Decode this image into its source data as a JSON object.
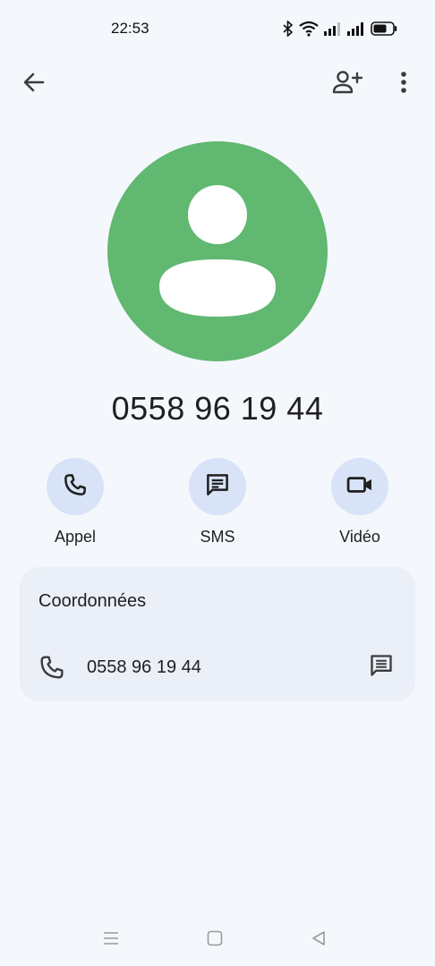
{
  "status_bar": {
    "time": "22:53",
    "icons": [
      "bluetooth-icon",
      "wifi-icon",
      "signal-icon",
      "signal-icon",
      "battery-icon"
    ],
    "battery_level": 0.7
  },
  "top_bar": {
    "back_icon": "arrow-left-icon",
    "add_contact_icon": "add-person-icon",
    "more_icon": "more-vert-icon"
  },
  "contact": {
    "number_display": "0558 96 19 44",
    "avatar_color": "#61b870"
  },
  "actions": [
    {
      "label": "Appel",
      "icon": "phone-icon"
    },
    {
      "label": "SMS",
      "icon": "message-icon"
    },
    {
      "label": "Vidéo",
      "icon": "videocam-icon"
    }
  ],
  "details": {
    "title": "Coordonnées",
    "phone": "0558 96 19 44",
    "phone_icon": "phone-icon",
    "message_icon": "message-icon"
  },
  "nav_bar": {
    "icons": [
      "menu-icon",
      "home-icon",
      "back-triangle-icon"
    ]
  },
  "colors": {
    "background": "#f4f7fc",
    "card": "#eaeff8",
    "action_circle": "#d8e3f7",
    "accent_dark": "#1f1f1f"
  }
}
